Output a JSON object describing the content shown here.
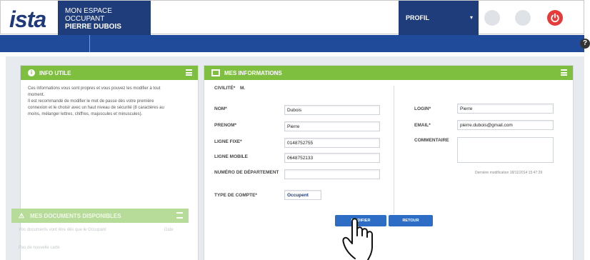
{
  "header": {
    "logo": "ista",
    "space_title": "MON ESPACE OCCUPANT",
    "user_name": "PIERRE DUBOIS",
    "profile_label": "PROFIL",
    "profile_caret": "▾"
  },
  "help_label": "?",
  "left_panel": {
    "title": "INFO UTILE",
    "text_lines": [
      "Ces informations vous sont propres et vous pouvez les modifier à tout",
      "moment.",
      "Il est recommandé de modifier le mot de passe dès votre première",
      "connexion et le choisir avec un haut niveau de sécurité (8 caractères au",
      "moins, mélanger lettres, chiffres, majuscules et minuscules)."
    ]
  },
  "docs_panel": {
    "title": "MES DOCUMENTS DISPONIBLES",
    "row_text": "Vos documents vont être dès que le Occupant",
    "row_date": "Date",
    "empty_text": "Pas de nouvelle carte"
  },
  "info_panel": {
    "title": "MES INFORMATIONS",
    "civilite_label": "CIVILITÉ*",
    "civilite_value": "M.",
    "nom_label": "NOM*",
    "nom_value": "Dubois",
    "prenom_label": "PRENOM*",
    "prenom_value": "Pierre",
    "ligne_fixe_label": "LIGNE FIXE*",
    "ligne_fixe_value": "0148752755",
    "ligne_mobile_label": "LIGNE MOBILE",
    "ligne_mobile_value": "0648752133",
    "departement_label": "NUMÉRO DE DÉPARTEMENT",
    "departement_value": "",
    "type_compte_label": "TYPE DE COMPTE*",
    "type_compte_value": "Occupent",
    "login_label": "LOGIN*",
    "login_value": "Pierre",
    "email_label": "EMAIL*",
    "email_value": "pierre.dubois@gmail.com",
    "commentaire_label": "COMMENTAIRE",
    "last_modified": "Dernière modification 18/11/2014 15:47:29",
    "modifier_button": "MODIFIER",
    "retour_button": "RETOUR"
  }
}
